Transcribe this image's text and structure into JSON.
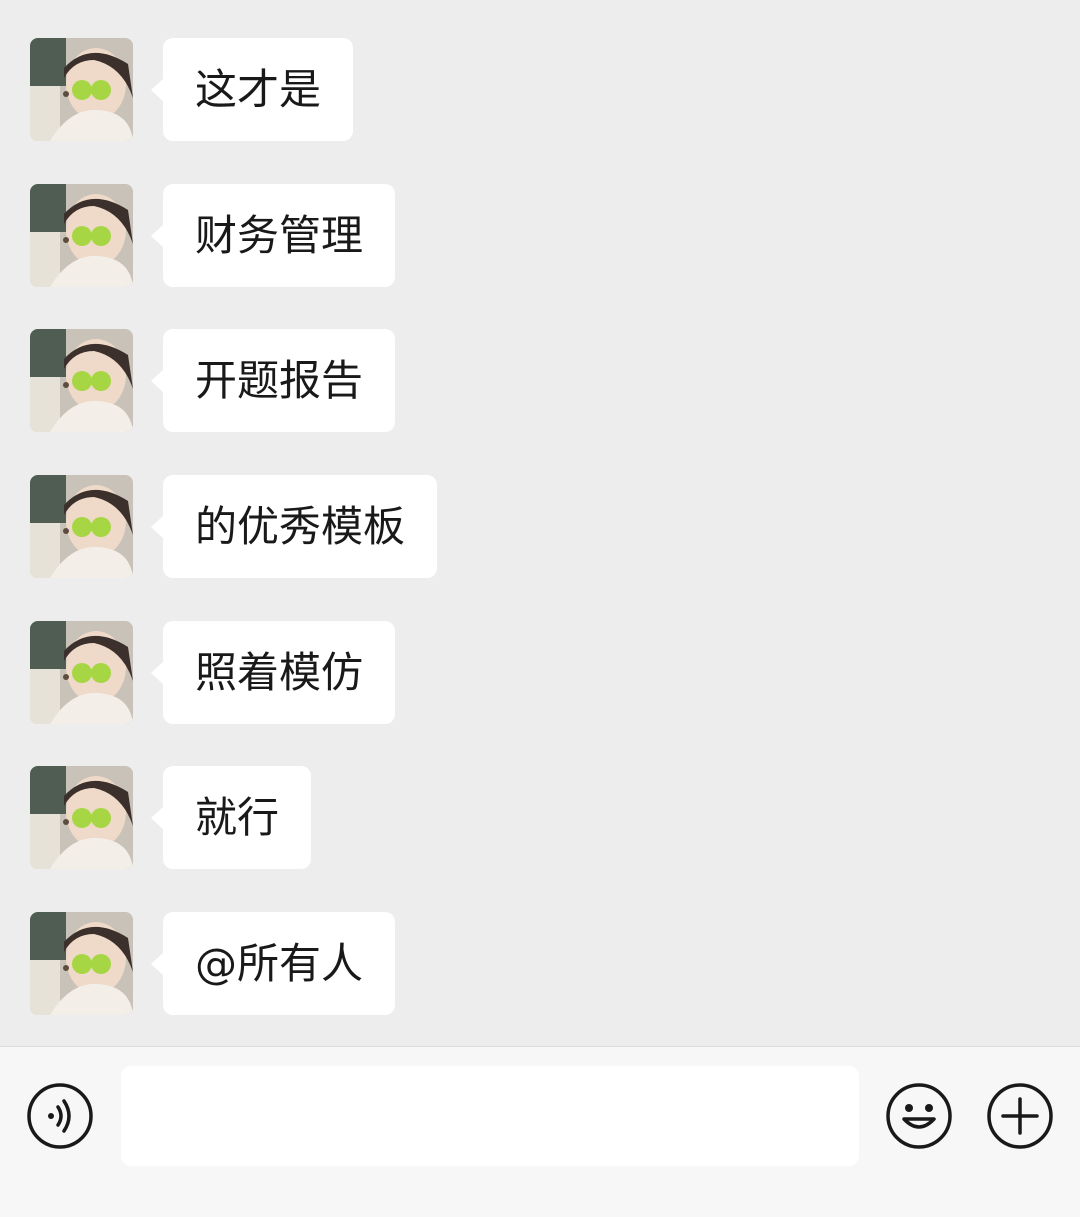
{
  "messages": [
    {
      "text": "这才是"
    },
    {
      "text": "财务管理"
    },
    {
      "text": "开题报告"
    },
    {
      "text": "的优秀模板"
    },
    {
      "text": "照着模仿"
    },
    {
      "text": "就行"
    },
    {
      "text": "@所有人"
    }
  ],
  "input_bar": {
    "text_value": "",
    "voice_icon": "voice-icon",
    "emoji_icon": "emoji-icon",
    "plus_icon": "plus-icon"
  },
  "colors": {
    "background": "#ededed",
    "bubble": "#ffffff",
    "text": "#191919",
    "input_bar": "#f7f7f7"
  }
}
